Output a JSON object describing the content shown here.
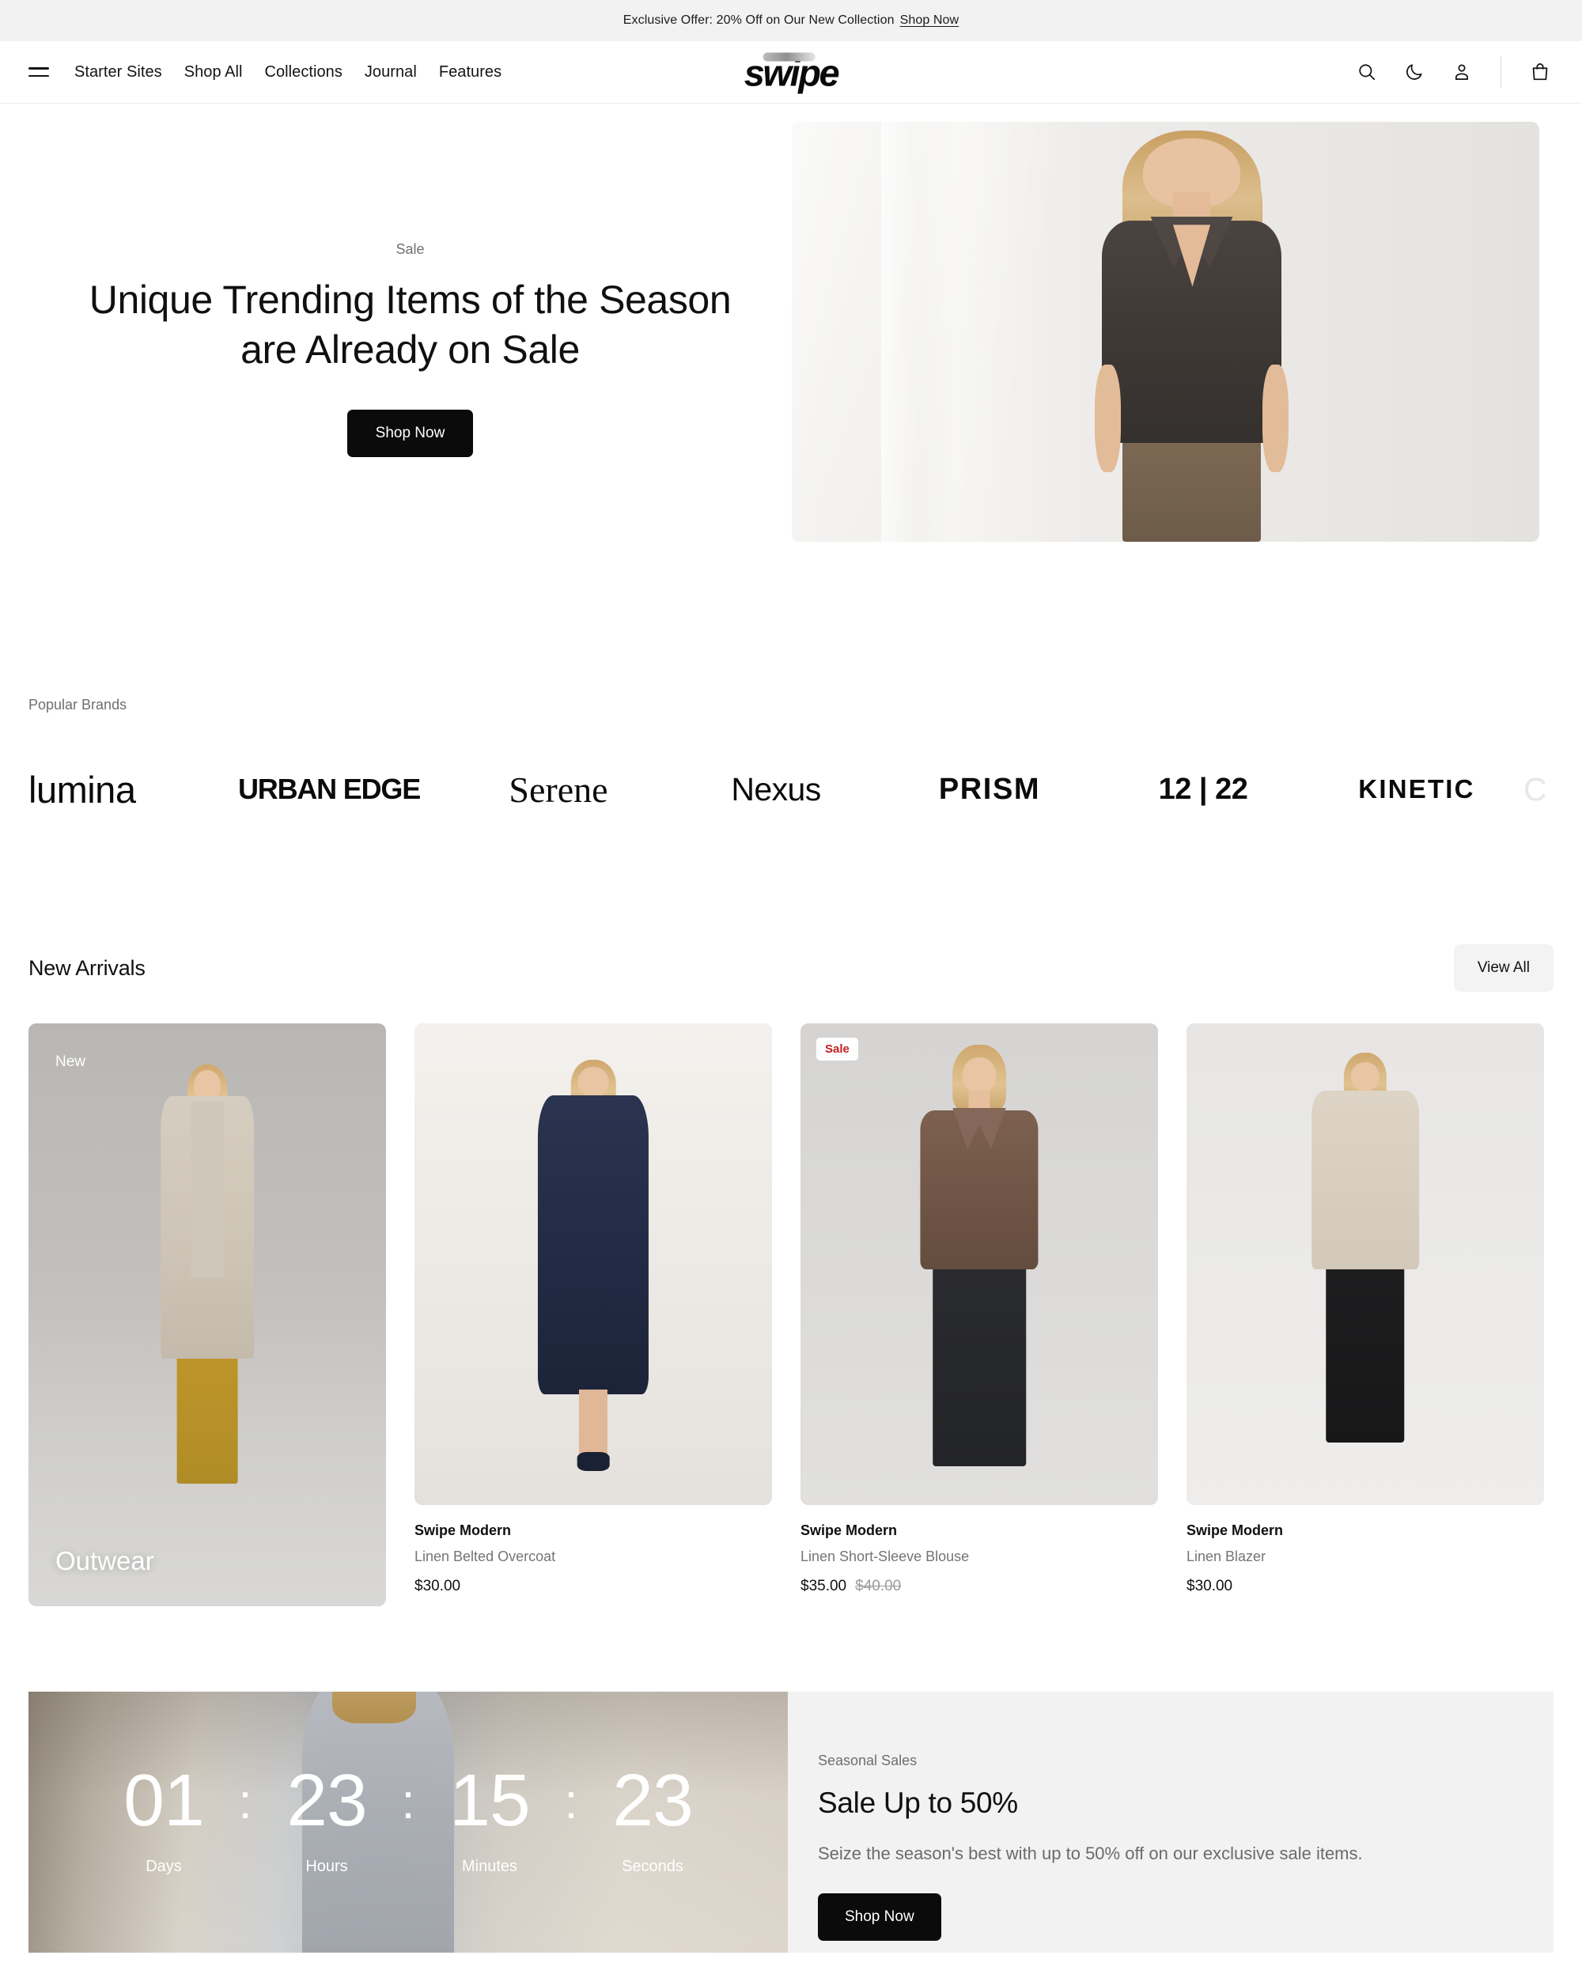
{
  "announcement": {
    "text": "Exclusive Offer: 20% Off on Our New Collection",
    "link_label": "Shop Now"
  },
  "header": {
    "logo": "swipe",
    "nav": [
      {
        "label": "Starter Sites"
      },
      {
        "label": "Shop All"
      },
      {
        "label": "Collections"
      },
      {
        "label": "Journal"
      },
      {
        "label": "Features"
      }
    ],
    "icons": [
      {
        "name": "search-icon"
      },
      {
        "name": "moon-icon"
      },
      {
        "name": "account-icon"
      },
      {
        "name": "cart-icon"
      }
    ]
  },
  "hero": {
    "eyebrow": "Sale",
    "title": "Unique Trending Items of the Season are Already on Sale",
    "cta": "Shop Now"
  },
  "brands": {
    "label": "Popular Brands",
    "items": [
      {
        "name": "lumina"
      },
      {
        "name": "URBAN EDGE"
      },
      {
        "name": "Serene"
      },
      {
        "name": "Nexus"
      },
      {
        "name": "PRISM"
      },
      {
        "name": "12 | 22"
      },
      {
        "name": "KINETIC"
      },
      {
        "name": "C"
      }
    ]
  },
  "new_arrivals": {
    "title": "New Arrivals",
    "view_all": "View All",
    "products": [
      {
        "badge": "New",
        "category_overlay": "Outwear",
        "vendor": "",
        "name": "",
        "price": "",
        "compare_at": ""
      },
      {
        "badge": "",
        "category_overlay": "",
        "vendor": "Swipe Modern",
        "name": "Linen Belted Overcoat",
        "price": "$30.00",
        "compare_at": ""
      },
      {
        "badge": "Sale",
        "category_overlay": "",
        "vendor": "Swipe Modern",
        "name": "Linen Short-Sleeve Blouse",
        "price": "$35.00",
        "compare_at": "$40.00"
      },
      {
        "badge": "",
        "category_overlay": "",
        "vendor": "Swipe Modern",
        "name": "Linen Blazer",
        "price": "$30.00",
        "compare_at": ""
      }
    ]
  },
  "countdown": {
    "units": [
      {
        "value": "01",
        "label": "Days"
      },
      {
        "value": "23",
        "label": "Hours"
      },
      {
        "value": "15",
        "label": "Minutes"
      },
      {
        "value": "23",
        "label": "Seconds"
      }
    ],
    "separator": ":"
  },
  "seasonal": {
    "eyebrow": "Seasonal Sales",
    "title": "Sale Up to 50%",
    "body": "Seize the season's best with up to 50% off on our exclusive sale items.",
    "cta": "Shop Now"
  },
  "colors": {
    "accent_dark": "#0b0b0b",
    "sale_red": "#c41f1f",
    "muted_text": "#6f6f6f",
    "surface_grey": "#f2f2f2"
  }
}
